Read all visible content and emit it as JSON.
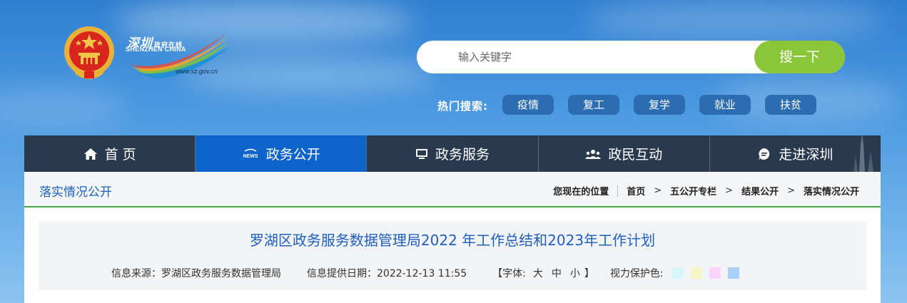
{
  "logo": {
    "cn_name": "深圳",
    "cn_sub": "政府在线",
    "en_name": "SHENZHEN CHINA",
    "url": "www.sz.gov.cn"
  },
  "search": {
    "placeholder": "输入关键字",
    "button_label": "搜一下"
  },
  "hot_search": {
    "label": "热门搜索:",
    "tags": [
      "疫情",
      "复工",
      "复学",
      "就业",
      "扶贫"
    ]
  },
  "nav": {
    "items": [
      {
        "label": "首 页",
        "icon": "home-icon"
      },
      {
        "label": "政务公开",
        "icon": "news-icon"
      },
      {
        "label": "政务服务",
        "icon": "monitor-icon"
      },
      {
        "label": "政民互动",
        "icon": "users-icon"
      },
      {
        "label": "走进深圳",
        "icon": "chat-icon"
      }
    ],
    "active_index": 1
  },
  "section": {
    "title": "落实情况公开"
  },
  "breadcrumb": {
    "label": "您现在的位置",
    "items": [
      "首页",
      "五公开专栏",
      "结果公开",
      "落实情况公开"
    ]
  },
  "article": {
    "title": "罗湖区政务服务数据管理局2022 年工作总结和2023年工作计划",
    "source": "信息来源：罗湖区政务服务数据管理局",
    "date": "信息提供日期：2022-12-13 11:55",
    "font_label_open": "【字体:",
    "font_large": "大",
    "font_medium": "中",
    "font_small": "小",
    "font_label_close": "】",
    "eye_protect_label": "视力保护色:",
    "eye_colors": [
      "#d6f6fb",
      "#f6f5c6",
      "#fbd4fb",
      "#a8d0f8"
    ]
  },
  "colors": {
    "nav_bg": "#293a4e",
    "nav_active": "#0f64cc",
    "search_button": "#8bc53a",
    "hot_tag": "#2c6cb0",
    "title_blue": "#1f5fbf",
    "divider_green": "#4aa34d"
  }
}
